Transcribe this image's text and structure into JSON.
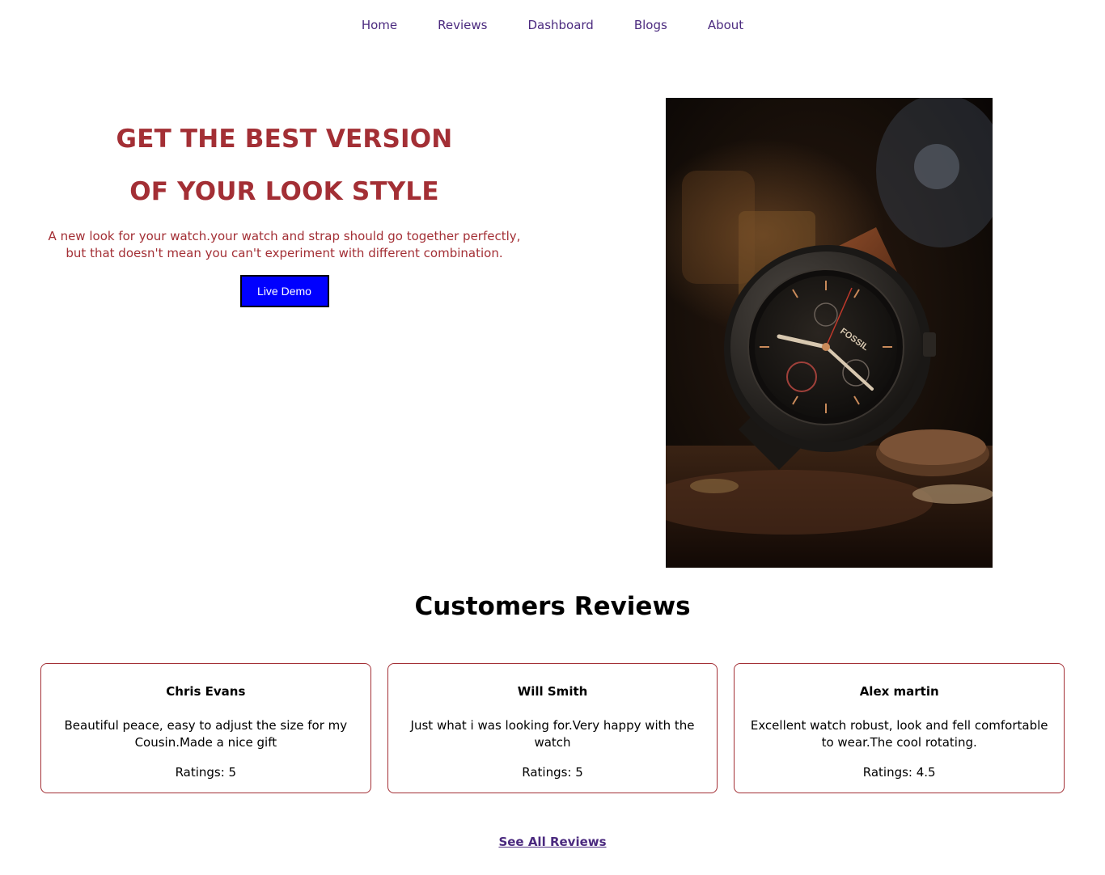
{
  "nav": {
    "items": [
      "Home",
      "Reviews",
      "Dashboard",
      "Blogs",
      "About"
    ]
  },
  "hero": {
    "title_line1": "GET THE BEST VERSION",
    "title_line2": "OF YOUR LOOK STYLE",
    "description": "A new look for your watch.your watch and strap should go together perfectly, but that doesn't mean you can't experiment with different combination.",
    "button_label": "Live Demo",
    "image_icon": "watch-photo",
    "watch_brand": "FOSSIL"
  },
  "reviews": {
    "title": "Customers Reviews",
    "items": [
      {
        "name": "Chris Evans",
        "text": "Beautiful peace, easy to adjust the size for my Cousin.Made a nice gift",
        "rating": "Ratings: 5"
      },
      {
        "name": "Will Smith",
        "text": "Just what i was looking for.Very happy with the watch",
        "rating": "Ratings: 5"
      },
      {
        "name": "Alex martin",
        "text": "Excellent watch robust, look and fell comfortable to wear.The cool rotating.",
        "rating": "Ratings: 4.5"
      }
    ],
    "see_all_label": "See All Reviews"
  },
  "colors": {
    "accent": "#a32f35",
    "nav_link": "#4b2a7f",
    "button_bg": "#0000ff"
  }
}
